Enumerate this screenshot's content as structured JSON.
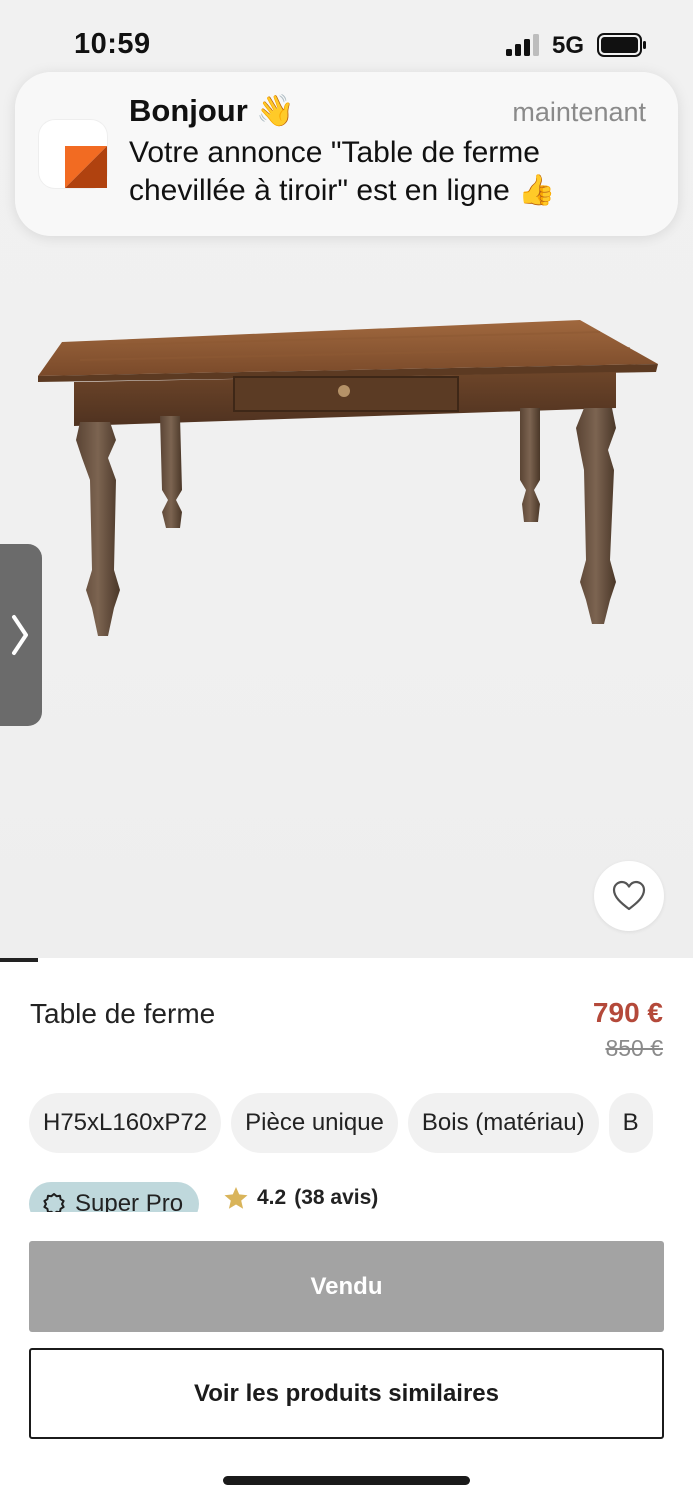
{
  "status_bar": {
    "time": "10:59",
    "network": "5G"
  },
  "notification": {
    "title": "Bonjour 👋",
    "time": "maintenant",
    "body": "Votre annonce \"Table de ferme chevillée à tiroir\" est en ligne 👍"
  },
  "gallery": {
    "progress": 0.055
  },
  "product": {
    "title": "Table de ferme",
    "price": "790 €",
    "old_price": "850 €",
    "tags": [
      "H75xL160xP72",
      "Pièce unique",
      "Bois (matériau)",
      "B"
    ]
  },
  "seller": {
    "badge": "Super Pro",
    "rating": "4.2",
    "reviews": "(38 avis)"
  },
  "actions": {
    "sold_label": "Vendu",
    "similar_label": "Voir les produits similaires"
  },
  "colors": {
    "price": "#b4493a",
    "badge_bg": "#bfd8dc",
    "brand_orange": "#f26b22",
    "brand_dark": "#b0420f",
    "star": "#d9b45a"
  }
}
